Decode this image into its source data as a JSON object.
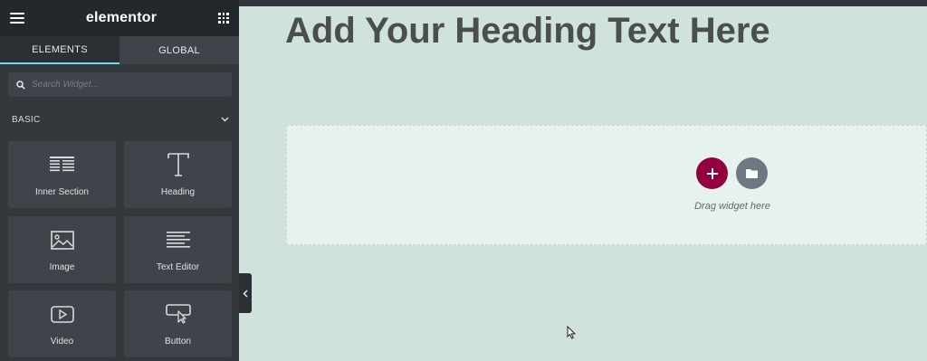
{
  "panel": {
    "logo": "elementor",
    "tabs": [
      {
        "label": "ELEMENTS",
        "active": true
      },
      {
        "label": "GLOBAL",
        "active": false
      }
    ],
    "search_placeholder": "Search Widget...",
    "category": "BASIC",
    "widgets": [
      {
        "label": "Inner Section",
        "icon": "inner-section-icon"
      },
      {
        "label": "Heading",
        "icon": "heading-icon"
      },
      {
        "label": "Image",
        "icon": "image-icon"
      },
      {
        "label": "Text Editor",
        "icon": "text-editor-icon"
      },
      {
        "label": "Video",
        "icon": "video-icon"
      },
      {
        "label": "Button",
        "icon": "button-icon"
      }
    ]
  },
  "canvas": {
    "heading": "Add Your Heading Text Here",
    "drop_text": "Drag widget here"
  },
  "colors": {
    "panel_bg": "#34383c",
    "accent_tab": "#71d7f7",
    "add_button": "#93003f",
    "template_button": "#6d7882",
    "canvas_bg": "#cfe3dc"
  }
}
